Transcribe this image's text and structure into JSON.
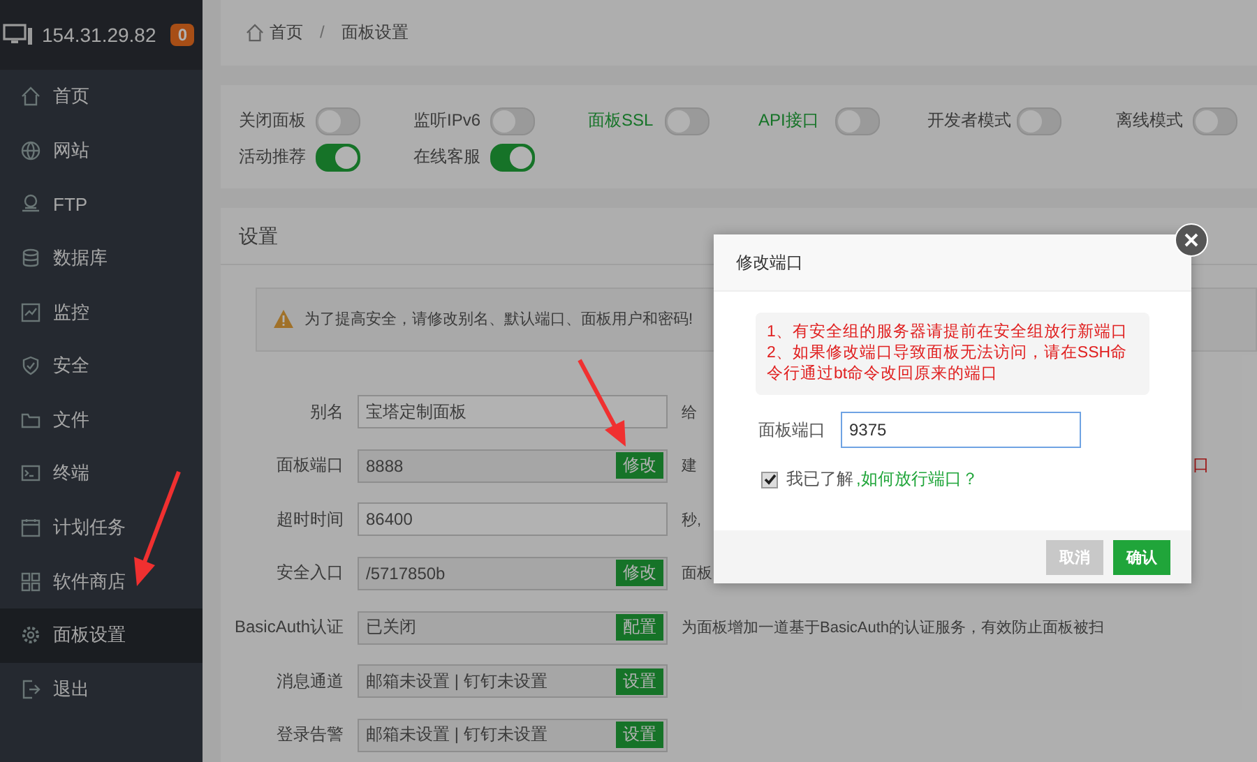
{
  "sidebar": {
    "server": "154.31.29.82",
    "badge": "0",
    "items": [
      {
        "label": "首页",
        "selected": false
      },
      {
        "label": "网站",
        "selected": false
      },
      {
        "label": "FTP",
        "selected": false
      },
      {
        "label": "数据库",
        "selected": false
      },
      {
        "label": "监控",
        "selected": false
      },
      {
        "label": "安全",
        "selected": false
      },
      {
        "label": "文件",
        "selected": false
      },
      {
        "label": "终端",
        "selected": false
      },
      {
        "label": "计划任务",
        "selected": false
      },
      {
        "label": "软件商店",
        "selected": false
      },
      {
        "label": "面板设置",
        "selected": true
      },
      {
        "label": "退出",
        "selected": false
      }
    ]
  },
  "breadcrumb": {
    "items": [
      "首页",
      "面板设置"
    ],
    "separator": "/"
  },
  "toggles": [
    {
      "label": "关闭面板",
      "on": false,
      "accent": false
    },
    {
      "label": "监听IPv6",
      "on": false,
      "accent": false
    },
    {
      "label": "面板SSL",
      "on": false,
      "accent": true
    },
    {
      "label": "API接口",
      "on": false,
      "accent": true
    },
    {
      "label": "开发者模式",
      "on": false,
      "accent": false
    },
    {
      "label": "离线模式",
      "on": false,
      "accent": false
    },
    {
      "label": "活动推荐",
      "on": true,
      "accent": false
    },
    {
      "label": "在线客服",
      "on": true,
      "accent": false
    }
  ],
  "settings": {
    "title": "设置",
    "alert": "为了提高安全，请修改别名、默认端口、面板用户和密码!",
    "rows": [
      {
        "label": "别名",
        "value": "宝塔定制面板",
        "readonly": false,
        "hint": "给"
      },
      {
        "label": "面板端口",
        "value": "8888",
        "readonly": true,
        "button": "修改",
        "hint": "建",
        "hint_tail": "口"
      },
      {
        "label": "超时时间",
        "value": "86400",
        "readonly": false,
        "hint": "秒,"
      },
      {
        "label": "安全入口",
        "value": "/5717850b",
        "readonly": true,
        "button": "修改",
        "hint": "面板"
      },
      {
        "label": "BasicAuth认证",
        "value": "已关闭",
        "readonly": true,
        "button": "配置",
        "hint": "为面板增加一道基于BasicAuth的认证服务，有效防止面板被扫"
      },
      {
        "label": "消息通道",
        "value": "邮箱未设置 | 钉钉未设置",
        "readonly": true,
        "button": "设置"
      },
      {
        "label": "登录告警",
        "value": "邮箱未设置 | 钉钉未设置",
        "readonly": true,
        "button": "设置"
      }
    ]
  },
  "dialog": {
    "title": "修改端口",
    "notes": [
      "1、有安全组的服务器请提前在安全组放行新端口",
      "2、如果修改端口导致面板无法访问，请在SSH命令行通过bt命令改回原来的端口"
    ],
    "port_label": "面板端口",
    "port_value": "9375",
    "agree": {
      "label": "我已了解",
      "checked": true
    },
    "link": ",如何放行端口？",
    "buttons": [
      {
        "label": "取消",
        "kind": "cancel"
      },
      {
        "label": "确认",
        "kind": "confirm"
      }
    ]
  }
}
